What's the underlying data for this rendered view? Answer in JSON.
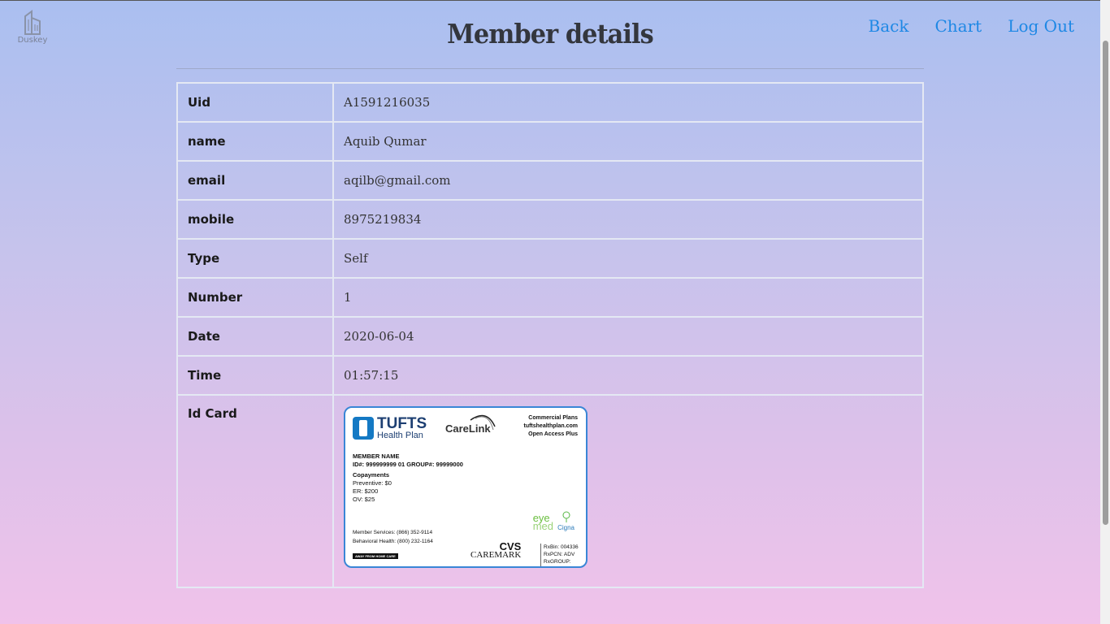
{
  "brand": {
    "logo_text": "Duskey",
    "logo_icon": "building-icon"
  },
  "header": {
    "title": "Member details"
  },
  "nav": {
    "back": "Back",
    "chart": "Chart",
    "logout": "Log Out"
  },
  "details": [
    {
      "label": "Uid",
      "value": "A1591216035"
    },
    {
      "label": "name",
      "value": "Aquib Qumar"
    },
    {
      "label": "email",
      "value": "aqilb@gmail.com"
    },
    {
      "label": "mobile",
      "value": "8975219834"
    },
    {
      "label": "Type",
      "value": "Self"
    },
    {
      "label": "Number",
      "value": "1"
    },
    {
      "label": "Date",
      "value": "2020-06-04"
    },
    {
      "label": "Time",
      "value": "01:57:15"
    },
    {
      "label": "Id Card",
      "value": ""
    }
  ],
  "id_card": {
    "brand_big": "TUFTS",
    "brand_small": "Health Plan",
    "carelink": "CareLink",
    "right_lines": [
      "Commercial Plans",
      "tuftshealthplan.com",
      "Open Access Plus"
    ],
    "member_name": "MEMBER NAME",
    "id_line": "ID#: 999999999   01     GROUP#: 99999000",
    "copay_title": "Copayments",
    "copays": [
      "Preventive: $0",
      "ER: $200",
      "OV: $25"
    ],
    "eyemed_1": "eye",
    "eyemed_2": "med",
    "cigna": "Cigna",
    "services": [
      "Member Services: (866) 352-9114",
      "Behavioral Health: (800) 232-1164"
    ],
    "away": "AWAY FROM HOME CARE",
    "cvs_1": "CVS",
    "cvs_2": "CAREMARK",
    "rx": [
      "RxBin: 004336",
      "RxPCN: ADV",
      "RxGROUP: RXTHP"
    ]
  }
}
